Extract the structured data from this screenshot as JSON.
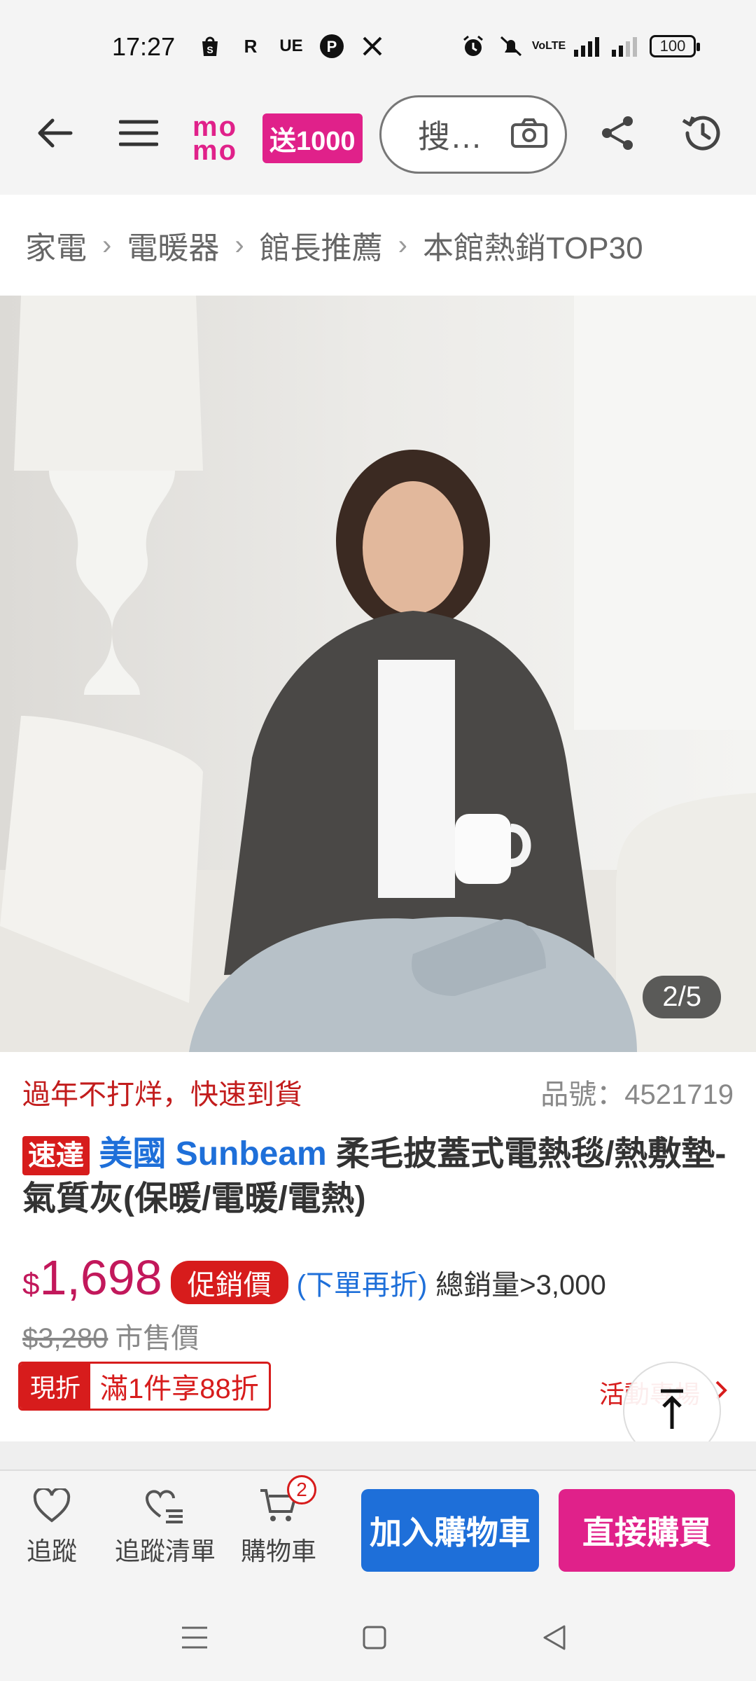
{
  "status_bar": {
    "time": "17:27",
    "battery": "100",
    "icons": [
      "shopping-bag-icon",
      "r-icon",
      "ue-icon",
      "p-icon",
      "x-icon",
      "alarm-icon",
      "mute-icon",
      "volte-icon",
      "4g-signal-icon",
      "signal-icon",
      "battery-icon"
    ]
  },
  "header": {
    "logo_text": "mo mo",
    "logo_badge": "送1000",
    "search_placeholder": "搜…"
  },
  "breadcrumb": [
    "家電",
    "電暖器",
    "館長推薦",
    "本館熱銷TOP30"
  ],
  "gallery": {
    "counter": "2/5"
  },
  "product": {
    "promo_text": "過年不打烊，快速到貨",
    "sku": "品號：4521719",
    "fast_tag": "速達",
    "brand": "美國 Sunbeam",
    "title": " 柔毛披蓋式電熱毯/熱敷墊-氣質灰(保暖/電暖/電熱)",
    "currency": "$",
    "price": "1,698",
    "promo_tag": "促銷價",
    "discount_link": "(下單再折)",
    "sales": "總銷量>3,000",
    "original_price": "$3,280",
    "original_label": "市售價",
    "coupon_label": "現折",
    "coupon_text": "滿1件享88折",
    "campaign_link": "活動專場"
  },
  "action_bar": {
    "track": "追蹤",
    "track_list": "追蹤清單",
    "cart": "購物車",
    "cart_count": "2",
    "add_to_cart": "加入購物車",
    "buy_now": "直接購買"
  },
  "colors": {
    "brand_pink": "#e0218a",
    "link_blue": "#1e6fd9",
    "promo_red": "#d71c1c",
    "price_magenta": "#c2185b"
  }
}
